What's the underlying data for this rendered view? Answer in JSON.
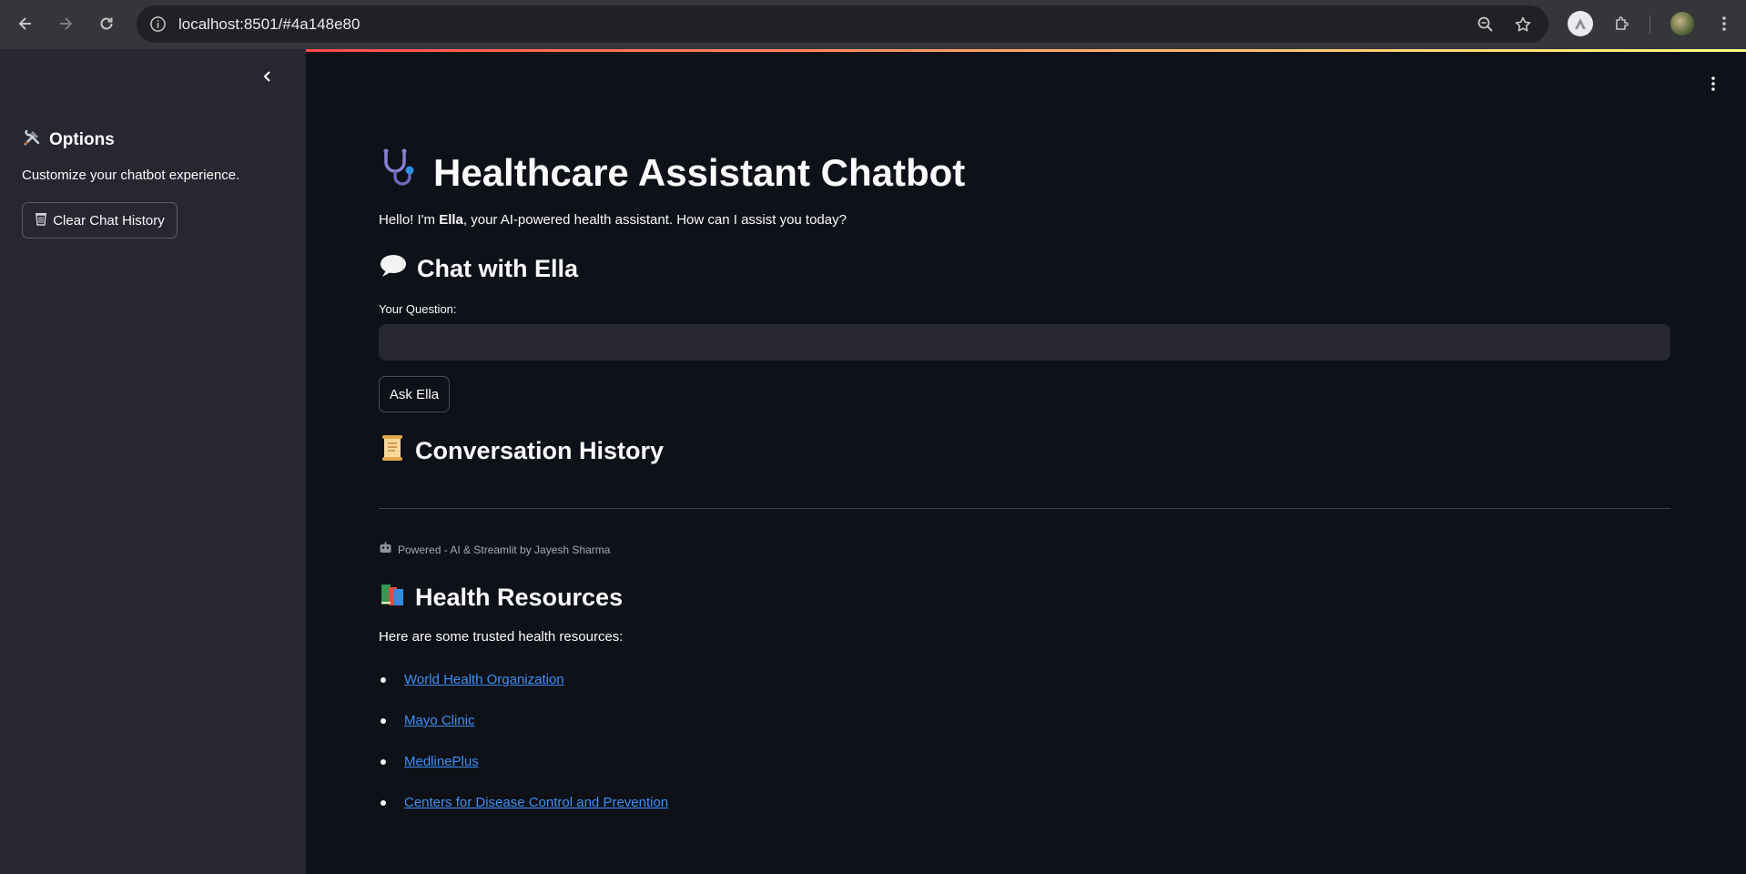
{
  "browser": {
    "url": "localhost:8501/#4a148e80",
    "icons": [
      "back-arrow-icon",
      "forward-arrow-icon",
      "reload-icon",
      "info-icon",
      "zoom-icon",
      "star-icon",
      "extensions-icon",
      "menu-dots-icon"
    ]
  },
  "sidebar": {
    "title": "Options",
    "title_icon": "hammer-wrench-icon",
    "description": "Customize your chatbot experience.",
    "clear_button": "Clear Chat History",
    "clear_button_icon": "wastebasket-icon"
  },
  "main": {
    "title": "Healthcare Assistant Chatbot",
    "title_icon": "stethoscope-icon",
    "intro_prefix": "Hello! I'm ",
    "intro_name": "Ella",
    "intro_suffix": ", your AI-powered health assistant. How can I assist you today?",
    "chat_heading": "Chat with Ella",
    "chat_icon": "speech-bubble-icon",
    "question_label": "Your Question:",
    "question_value": "",
    "ask_button": "Ask Ella",
    "history_heading": "Conversation History",
    "history_icon": "scroll-icon",
    "footer_caption": "Powered - AI & Streamlit by Jayesh Sharma",
    "footer_icon": "robot-icon",
    "resources_heading": "Health Resources",
    "resources_icon": "books-icon",
    "resources_intro": "Here are some trusted health resources:",
    "resources": [
      {
        "label": "World Health Organization"
      },
      {
        "label": "Mayo Clinic"
      },
      {
        "label": "MedlinePlus"
      },
      {
        "label": "Centers for Disease Control and Prevention"
      }
    ]
  },
  "colors": {
    "background": "#0e1117",
    "sidebar": "#262730",
    "link": "#3d8ef5",
    "accent_gradient": [
      "#ff4b4b",
      "#fffd80"
    ]
  }
}
